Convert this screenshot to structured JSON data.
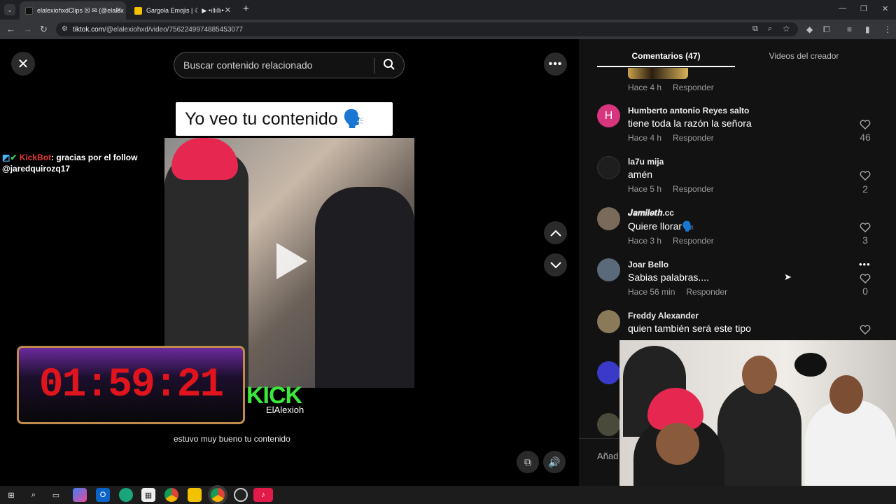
{
  "browser": {
    "tabs": [
      {
        "title": "elalexiohxdClips ☒ ✉ (@elalex",
        "active": true
      },
      {
        "title": "Gargola Emojis | ☾ ▶ •ıllıllı•",
        "active": false
      }
    ],
    "new_tab": "+",
    "window_controls": [
      "—",
      "❐",
      "✕"
    ],
    "url_domain": "tiktok.com",
    "url_path": "/@elalexiohxd/video/7562249974885453077"
  },
  "page": {
    "search_placeholder": "Buscar contenido relacionado",
    "caption_text": "Yo veo tu contenido 🗣️",
    "overlay_text": "estuvo muy bueno tu contenido",
    "chat": {
      "user": "KickBot",
      "message": ": gracias por el follow @jaredquirozq17"
    },
    "timer": "01:59:21",
    "kick_logo": "KICK",
    "kick_sub": "ElAlexioh"
  },
  "comments_panel": {
    "tab_comments": "Comentarios (47)",
    "tab_videos": "Videos del creador",
    "reply_label": "Responder",
    "add_comment_placeholder": "Añad",
    "first_meta_time": "Hace 4 h",
    "items": [
      {
        "name": "Humberto antonio Reyes salto",
        "text": "tiene toda la razón la señora",
        "time": "Hace 4 h",
        "likes": "46",
        "avatar_letter": "H",
        "avatar_color": "#d8357f"
      },
      {
        "name": "la7u mija",
        "text": "amén",
        "time": "Hace 5 h",
        "likes": "2",
        "avatar_letter": "",
        "avatar_color": "#222"
      },
      {
        "name": "𝑱𝒂𝒎𝒊𝒍𝒆𝒕𝒉.cc",
        "text": "Quiere llorar🗣️",
        "time": "Hace 3 h",
        "likes": "3",
        "avatar_letter": "",
        "avatar_color": "#7a6a5a"
      },
      {
        "name": "Joar Bello",
        "text": "Sabias palabras....",
        "time": "Hace 56 min",
        "likes": "0",
        "avatar_letter": "",
        "avatar_color": "#5a6a7a"
      },
      {
        "name": "Freddy Alexander",
        "text": "quien también será este tipo",
        "time": "",
        "likes": "",
        "avatar_letter": "",
        "avatar_color": "#8a7a5a"
      }
    ]
  },
  "taskbar": {
    "icons": [
      "windows-start",
      "search",
      "task-view",
      "copilot",
      "outlook",
      "edge",
      "store",
      "chrome",
      "file-explorer",
      "chrome-active",
      "obs",
      "tiktok"
    ]
  }
}
